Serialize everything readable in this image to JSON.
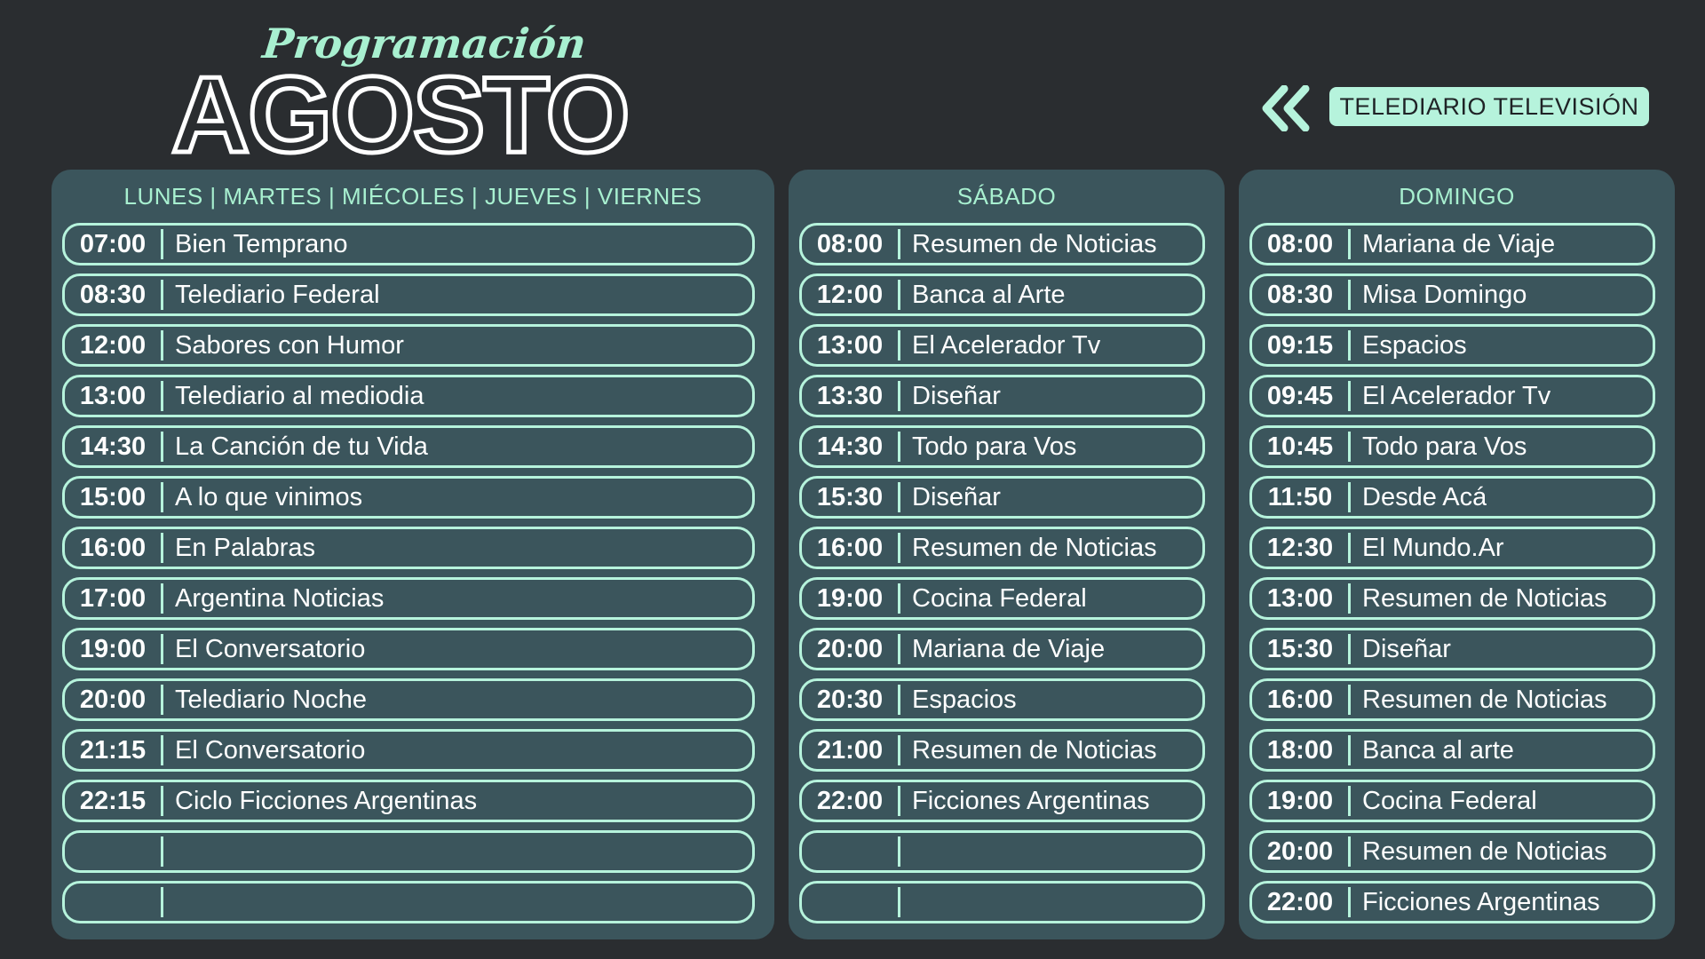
{
  "header": {
    "subtitle": "Programación",
    "title": "AGOSTO",
    "channel": "TELEDIARIO TELEVISIÓN",
    "back_icon": "double-chevron-left-icon"
  },
  "colors": {
    "background": "#2a2d30",
    "panel": "#3b555c",
    "accent": "#b6f3dc",
    "text": "#ffffff"
  },
  "weekdays": {
    "header": "LUNES | MARTES | MIÉCOLES | JUEVES | VIERNES",
    "rows": [
      {
        "time": "07:00",
        "program": "Bien Temprano"
      },
      {
        "time": "08:30",
        "program": "Telediario Federal"
      },
      {
        "time": "12:00",
        "program": "Sabores con Humor"
      },
      {
        "time": "13:00",
        "program": "Telediario al mediodia"
      },
      {
        "time": "14:30",
        "program": "La Canción de tu Vida"
      },
      {
        "time": "15:00",
        "program": "A lo que vinimos"
      },
      {
        "time": "16:00",
        "program": "En Palabras"
      },
      {
        "time": "17:00",
        "program": "Argentina Noticias"
      },
      {
        "time": "19:00",
        "program": "El Conversatorio"
      },
      {
        "time": "20:00",
        "program": "Telediario Noche"
      },
      {
        "time": "21:15",
        "program": "El Conversatorio"
      },
      {
        "time": "22:15",
        "program": "Ciclo Ficciones Argentinas"
      },
      {
        "time": "",
        "program": ""
      },
      {
        "time": "",
        "program": ""
      }
    ]
  },
  "saturday": {
    "header": "SÁBADO",
    "rows": [
      {
        "time": "08:00",
        "program": "Resumen de Noticias"
      },
      {
        "time": "12:00",
        "program": "Banca al Arte"
      },
      {
        "time": "13:00",
        "program": "El Acelerador Tv"
      },
      {
        "time": "13:30",
        "program": "Diseñar"
      },
      {
        "time": "14:30",
        "program": "Todo para Vos"
      },
      {
        "time": "15:30",
        "program": "Diseñar"
      },
      {
        "time": "16:00",
        "program": "Resumen de Noticias"
      },
      {
        "time": "19:00",
        "program": "Cocina Federal"
      },
      {
        "time": "20:00",
        "program": "Mariana de Viaje"
      },
      {
        "time": "20:30",
        "program": "Espacios"
      },
      {
        "time": "21:00",
        "program": "Resumen de Noticias"
      },
      {
        "time": "22:00",
        "program": "Ficciones Argentinas"
      },
      {
        "time": "",
        "program": ""
      },
      {
        "time": "",
        "program": ""
      }
    ]
  },
  "sunday": {
    "header": "DOMINGO",
    "rows": [
      {
        "time": "08:00",
        "program": "Mariana de Viaje"
      },
      {
        "time": "08:30",
        "program": "Misa Domingo"
      },
      {
        "time": "09:15",
        "program": "Espacios"
      },
      {
        "time": "09:45",
        "program": "El Acelerador Tv"
      },
      {
        "time": "10:45",
        "program": "Todo para Vos"
      },
      {
        "time": "11:50",
        "program": "Desde Acá"
      },
      {
        "time": "12:30",
        "program": "El Mundo.Ar"
      },
      {
        "time": "13:00",
        "program": "Resumen de Noticias"
      },
      {
        "time": "15:30",
        "program": "Diseñar"
      },
      {
        "time": "16:00",
        "program": "Resumen de Noticias"
      },
      {
        "time": "18:00",
        "program": "Banca al arte"
      },
      {
        "time": "19:00",
        "program": "Cocina Federal"
      },
      {
        "time": "20:00",
        "program": "Resumen de Noticias"
      },
      {
        "time": "22:00",
        "program": "Ficciones Argentinas"
      }
    ]
  }
}
